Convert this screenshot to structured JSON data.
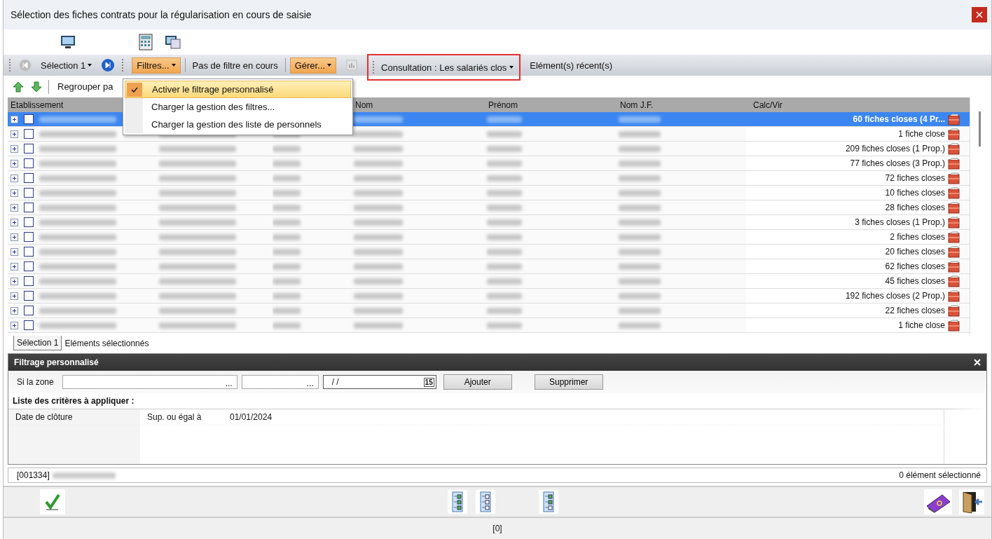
{
  "window": {
    "title": "Sélection des fiches contrats pour la régularisation en cours de saisie"
  },
  "toolbar": {
    "selection": "Sélection 1",
    "filters": "Filtres...",
    "filter_status": "Pas de filtre en cours",
    "manage": "Gérer...",
    "consultation": "Consultation : Les salariés clos",
    "recent": "Elément(s) récent(s)"
  },
  "toolbar2": {
    "group_by": "Regrouper pa"
  },
  "filters_menu": [
    {
      "label": "Activer le filtrage personnalisé",
      "checked": true,
      "selected": true
    },
    {
      "label": "Charger la gestion des filtres...",
      "checked": false,
      "selected": false
    },
    {
      "label": "Charger la gestion des liste de personnels",
      "checked": false,
      "selected": false
    }
  ],
  "table": {
    "columns": [
      "Etablissement",
      "Nom",
      "Prénom",
      "Nom J.F.",
      "Calc/Vir"
    ],
    "rows": [
      {
        "selected": true,
        "checked": false,
        "calc": "60 fiches closes (4 Pr..."
      },
      {
        "selected": false,
        "checked": false,
        "calc": "1 fiche close"
      },
      {
        "selected": false,
        "checked": false,
        "calc": "209 fiches closes (1 Prop.)"
      },
      {
        "selected": false,
        "checked": false,
        "calc": "77 fiches closes (3 Prop.)"
      },
      {
        "selected": false,
        "checked": false,
        "calc": "72 fiches closes"
      },
      {
        "selected": false,
        "checked": false,
        "calc": "10 fiches closes"
      },
      {
        "selected": false,
        "checked": false,
        "calc": "28 fiches closes"
      },
      {
        "selected": false,
        "checked": false,
        "calc": "3 fiches closes (1 Prop.)"
      },
      {
        "selected": false,
        "checked": false,
        "calc": "2 fiches closes"
      },
      {
        "selected": false,
        "checked": false,
        "calc": "20 fiches closes"
      },
      {
        "selected": false,
        "checked": false,
        "calc": "62 fiches closes"
      },
      {
        "selected": false,
        "checked": false,
        "calc": "45 fiches closes"
      },
      {
        "selected": false,
        "checked": false,
        "calc": "192 fiches closes (2 Prop.)"
      },
      {
        "selected": false,
        "checked": false,
        "calc": "22 fiches closes"
      },
      {
        "selected": false,
        "checked": false,
        "calc": "1 fiche close"
      }
    ]
  },
  "tabs": [
    {
      "label": "Sélection 1",
      "selected": true
    },
    {
      "label": "Eléments sélectionnés",
      "selected": false
    }
  ],
  "filter_panel": {
    "title": "Filtrage personnalisé",
    "zone_label": "Si la zone",
    "field_button": "...",
    "field_button_2": "...",
    "date_value": "/ /",
    "calendar": "15",
    "add": "Ajouter",
    "remove": "Supprimer",
    "criteria_heading": "Liste des critères à appliquer :",
    "criteria": [
      {
        "field": "Date de clôture",
        "operator": "Sup. ou égal à",
        "value": "01/01/2024"
      }
    ]
  },
  "status_bar": {
    "code": "[001334]",
    "selected_count": "0 élément sélectionné"
  },
  "footer": {
    "count": "[0]"
  }
}
